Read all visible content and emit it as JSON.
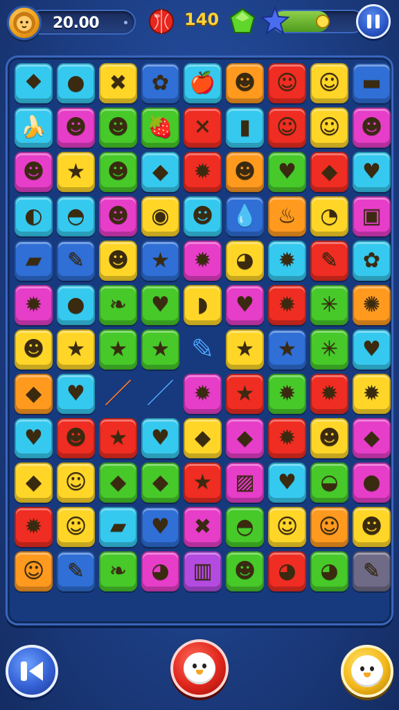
{
  "hud": {
    "coins": "20.00",
    "moves": "140",
    "progress": 0.62,
    "icons": {
      "avatar": "lion-avatar-icon",
      "ball": "red-ball-icon",
      "gem": "green-gem-icon",
      "star": "blue-star-icon",
      "pause": "pause-icon"
    }
  },
  "board": {
    "rows": 12,
    "cols": 9,
    "palette": {
      "cyan": "#36c9ef",
      "purple": "#b44be0",
      "yellow": "#ffd628",
      "blue": "#2f6fd6",
      "orange": "#ff9a1f",
      "red": "#ef2d22",
      "green": "#47c92a",
      "magenta": "#e63ec8",
      "grey": "#6f6a86"
    },
    "tiles": [
      [
        [
          "cyan",
          "⯁"
        ],
        [
          "cyan",
          "●"
        ],
        [
          "yellow",
          "✖"
        ],
        [
          "blue",
          "✿"
        ],
        [
          "cyan",
          "🍎"
        ],
        [
          "orange",
          "☻"
        ],
        [
          "red",
          "☺"
        ],
        [
          "yellow",
          "☺"
        ],
        [
          "blue",
          "▬"
        ]
      ],
      [
        [
          "cyan",
          "🍌"
        ],
        [
          "magenta",
          "☻"
        ],
        [
          "green",
          "☻"
        ],
        [
          "green",
          "🍓"
        ],
        [
          "red",
          "✕"
        ],
        [
          "cyan",
          "▮"
        ],
        [
          "red",
          "☺"
        ],
        [
          "yellow",
          "☺"
        ],
        [
          "magenta",
          "☻"
        ]
      ],
      [
        [
          "magenta",
          "☻"
        ],
        [
          "yellow",
          "★"
        ],
        [
          "green",
          "☻"
        ],
        [
          "cyan",
          "◆"
        ],
        [
          "red",
          "✹"
        ],
        [
          "orange",
          "☻"
        ],
        [
          "green",
          "♥"
        ],
        [
          "red",
          "◆"
        ],
        [
          "cyan",
          "♥"
        ]
      ],
      [
        [
          "cyan",
          "◐"
        ],
        [
          "cyan",
          "◓"
        ],
        [
          "magenta",
          "☻"
        ],
        [
          "yellow",
          "◉"
        ],
        [
          "cyan",
          "☻"
        ],
        [
          "blue",
          "💧"
        ],
        [
          "orange",
          "♨"
        ],
        [
          "yellow",
          "◔"
        ],
        [
          "magenta",
          "▣"
        ]
      ],
      [
        [
          "blue",
          "▰"
        ],
        [
          "blue",
          "✎"
        ],
        [
          "yellow",
          "☻"
        ],
        [
          "blue",
          "★"
        ],
        [
          "magenta",
          "✹"
        ],
        [
          "yellow",
          "◕"
        ],
        [
          "cyan",
          "✹"
        ],
        [
          "red",
          "✎"
        ],
        [
          "cyan",
          "✿"
        ]
      ],
      [
        [
          "magenta",
          "✹"
        ],
        [
          "cyan",
          "●"
        ],
        [
          "green",
          "❧"
        ],
        [
          "green",
          "♥"
        ],
        [
          "yellow",
          "◗"
        ],
        [
          "magenta",
          "♥"
        ],
        [
          "red",
          "✹"
        ],
        [
          "green",
          "✳"
        ],
        [
          "orange",
          "✺"
        ]
      ],
      [
        [
          "yellow",
          "☻"
        ],
        [
          "yellow",
          "★"
        ],
        [
          "green",
          "★"
        ],
        [
          "green",
          "★"
        ],
        [
          "empty",
          "✎"
        ],
        [
          "yellow",
          "★"
        ],
        [
          "blue",
          "★"
        ],
        [
          "green",
          "✳"
        ],
        [
          "cyan",
          "♥"
        ]
      ],
      [
        [
          "orange",
          "◆"
        ],
        [
          "cyan",
          "♥"
        ],
        [
          "empty",
          "／"
        ],
        [
          "empty",
          "／"
        ],
        [
          "magenta",
          "✹"
        ],
        [
          "red",
          "★"
        ],
        [
          "green",
          "✹"
        ],
        [
          "red",
          "✹"
        ],
        [
          "yellow",
          "✹"
        ]
      ],
      [
        [
          "cyan",
          "♥"
        ],
        [
          "red",
          "☻"
        ],
        [
          "red",
          "★"
        ],
        [
          "cyan",
          "♥"
        ],
        [
          "yellow",
          "◆"
        ],
        [
          "magenta",
          "◆"
        ],
        [
          "red",
          "✹"
        ],
        [
          "yellow",
          "☻"
        ],
        [
          "magenta",
          "◆"
        ]
      ],
      [
        [
          "yellow",
          "◆"
        ],
        [
          "yellow",
          "☺"
        ],
        [
          "green",
          "◆"
        ],
        [
          "green",
          "◆"
        ],
        [
          "red",
          "★"
        ],
        [
          "magenta",
          "▨"
        ],
        [
          "cyan",
          "♥"
        ],
        [
          "green",
          "◒"
        ],
        [
          "magenta",
          "●"
        ]
      ],
      [
        [
          "red",
          "✹"
        ],
        [
          "yellow",
          "☺"
        ],
        [
          "cyan",
          "▰"
        ],
        [
          "blue",
          "♥"
        ],
        [
          "magenta",
          "✖"
        ],
        [
          "green",
          "◓"
        ],
        [
          "yellow",
          "☺"
        ],
        [
          "orange",
          "☺"
        ],
        [
          "yellow",
          "☻"
        ]
      ],
      [
        [
          "orange",
          "☺"
        ],
        [
          "blue",
          "✎"
        ],
        [
          "green",
          "❧"
        ],
        [
          "magenta",
          "◕"
        ],
        [
          "purple",
          "▥"
        ],
        [
          "green",
          "☻"
        ],
        [
          "red",
          "◕"
        ],
        [
          "green",
          "◕"
        ],
        [
          "grey",
          "✎"
        ]
      ]
    ]
  },
  "controls": {
    "left_icon": "back-arrow-icon",
    "center_icon": "bird-face-icon",
    "right_icon": "bird-face-icon"
  }
}
